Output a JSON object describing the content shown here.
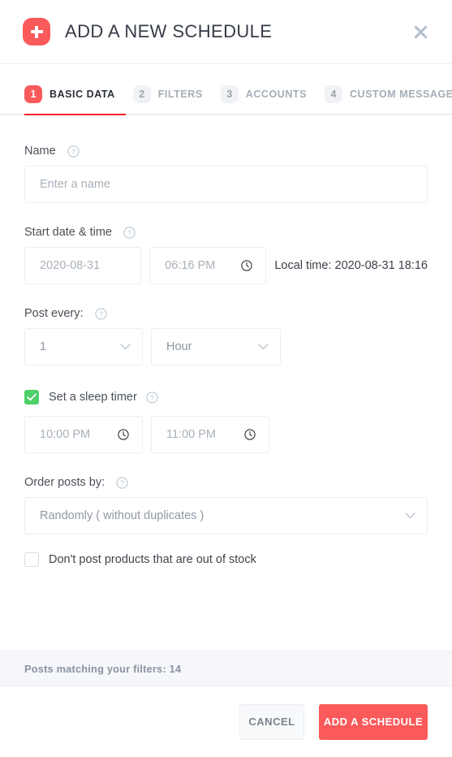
{
  "header": {
    "title": "ADD A NEW SCHEDULE",
    "add_icon": "plus-icon",
    "close_icon": "close-icon",
    "accent_color": "#fb5a5a"
  },
  "tabs": {
    "active_index": 0,
    "items": [
      {
        "number": "1",
        "label": "BASIC DATA"
      },
      {
        "number": "2",
        "label": "FILTERS"
      },
      {
        "number": "3",
        "label": "ACCOUNTS"
      },
      {
        "number": "4",
        "label": "CUSTOM MESSAGES"
      }
    ]
  },
  "form": {
    "name": {
      "label": "Name",
      "help_icon": "help-circle-icon",
      "placeholder": "Enter a name",
      "value": ""
    },
    "start": {
      "label": "Start date & time",
      "help_icon": "help-circle-icon",
      "date_value": "2020-08-31",
      "time_value": "06:16 PM",
      "time_icon": "clock-icon",
      "local_time": "Local time: 2020-08-31 18:16"
    },
    "post_every": {
      "label": "Post every:",
      "help_icon": "help-circle-icon",
      "amount_value": "1",
      "unit_value": "Hour",
      "chevron_icon": "chevron-down-icon"
    },
    "sleep_timer": {
      "label": "Set a sleep timer",
      "help_icon": "help-circle-icon",
      "checked": true,
      "check_color": "#4ed06a",
      "from_value": "10:00 PM",
      "to_value": "11:00 PM",
      "time_icon": "clock-icon"
    },
    "order_posts": {
      "label": "Order posts by:",
      "help_icon": "help-circle-icon",
      "value": "Randomly ( without duplicates )",
      "chevron_icon": "chevron-down-icon"
    },
    "out_of_stock": {
      "label": "Don't post products that are out of stock",
      "checked": false
    }
  },
  "status": {
    "text": "Posts matching your filters: 14"
  },
  "footer": {
    "cancel_label": "CANCEL",
    "submit_label": "ADD A SCHEDULE"
  }
}
